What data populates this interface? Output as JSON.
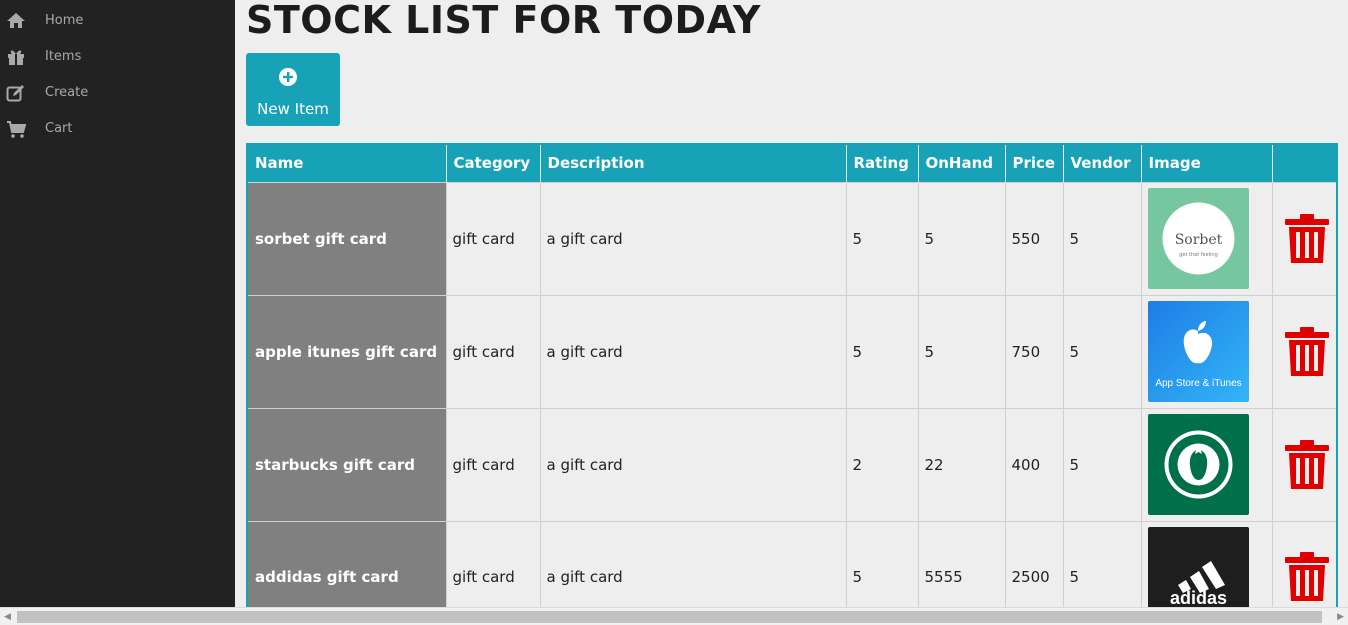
{
  "sidebar": {
    "items": [
      {
        "label": "Home",
        "icon": "home-icon"
      },
      {
        "label": "Items",
        "icon": "gift-icon"
      },
      {
        "label": "Create",
        "icon": "edit-icon"
      },
      {
        "label": "Cart",
        "icon": "cart-icon"
      }
    ]
  },
  "page": {
    "title": "STOCK LIST FOR TODAY",
    "new_item_label": "New Item"
  },
  "table": {
    "headers": [
      "Name",
      "Category",
      "Description",
      "Rating",
      "OnHand",
      "Price",
      "Vendor",
      "Image",
      ""
    ],
    "rows": [
      {
        "name": "sorbet gift card",
        "category": "gift card",
        "description": "a gift card",
        "rating": "5",
        "onhand": "5",
        "price": "550",
        "vendor": "5",
        "image_text": "Sorbet",
        "image_sub": "get that feeling",
        "image_bg": "#76c7a0"
      },
      {
        "name": "apple itunes gift card",
        "category": "gift card",
        "description": "a gift card",
        "rating": "5",
        "onhand": "5",
        "price": "750",
        "vendor": "5",
        "image_text": "App Store & iTunes",
        "image_bg": "#2a8ff0"
      },
      {
        "name": "starbucks gift card",
        "category": "gift card",
        "description": "a gift card",
        "rating": "2",
        "onhand": "22",
        "price": "400",
        "vendor": "5",
        "image_bg": "#00704a"
      },
      {
        "name": "addidas gift card",
        "category": "gift card",
        "description": "a gift card",
        "rating": "5",
        "onhand": "5555",
        "price": "2500",
        "vendor": "5",
        "image_text": "adidas",
        "image_bg": "#1e1e1e"
      }
    ]
  },
  "colors": {
    "accent": "#17a2b8",
    "sidebar_bg": "#222222",
    "delete": "#e00000"
  }
}
